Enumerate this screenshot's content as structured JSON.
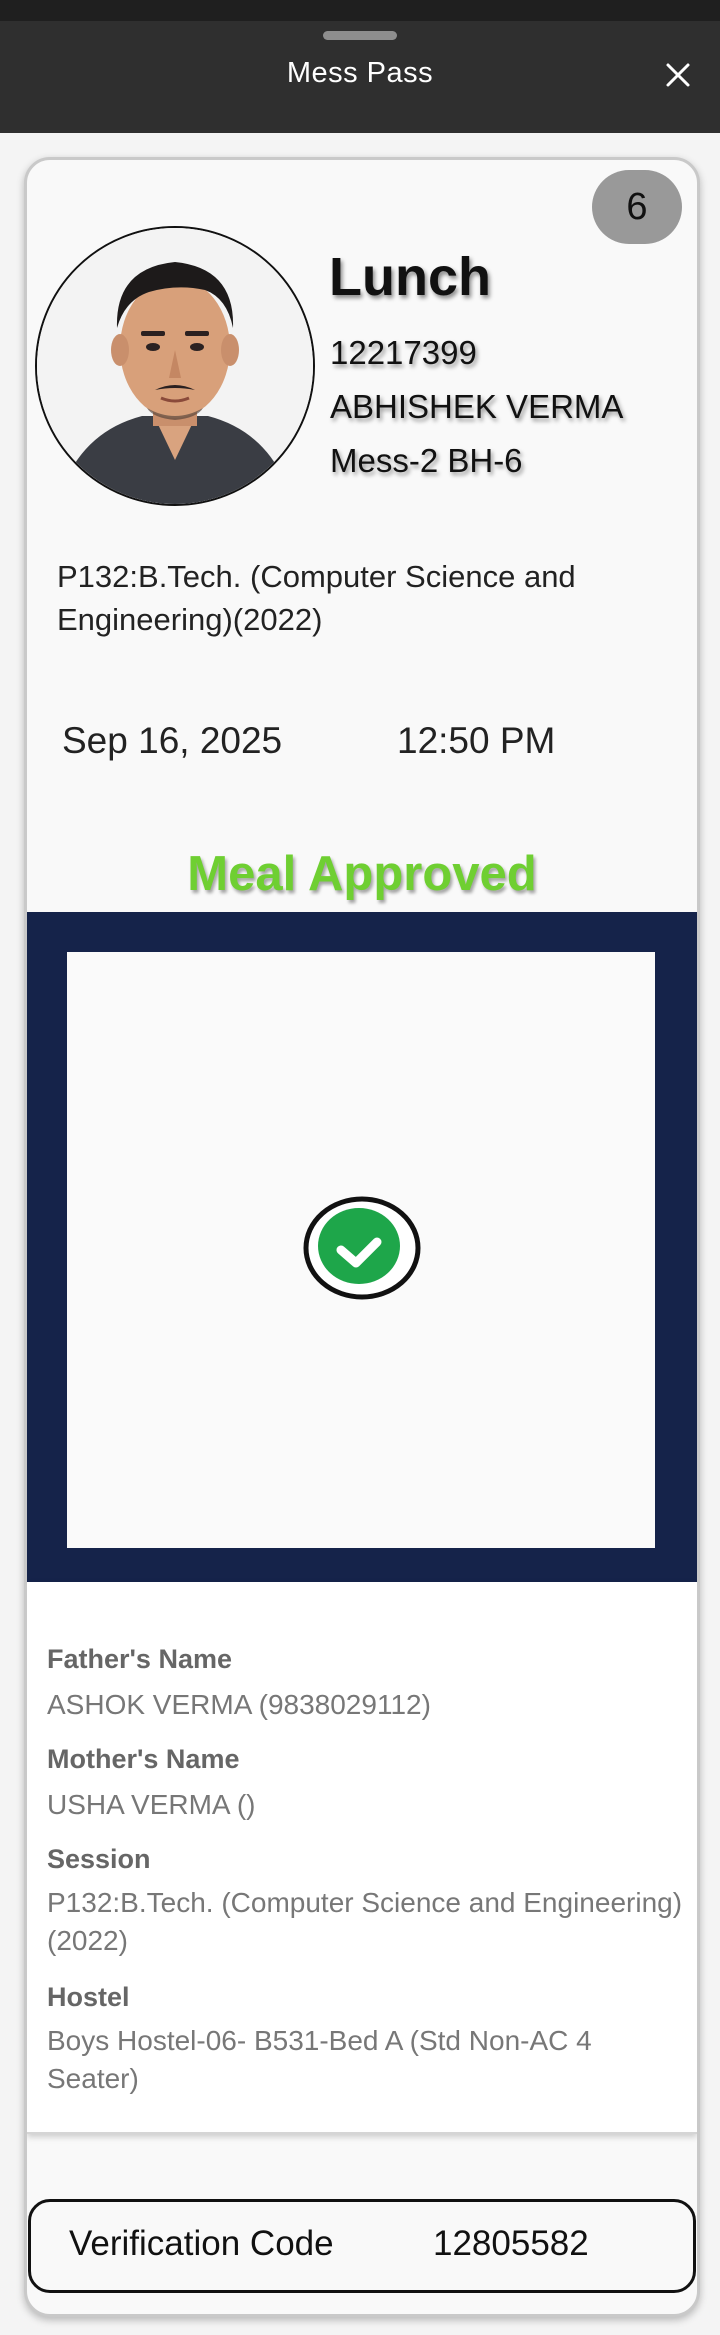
{
  "header": {
    "title": "Mess Pass",
    "close_icon": "close-icon"
  },
  "pass": {
    "count": "6",
    "meal_type": "Lunch",
    "roll_no": "12217399",
    "student_name": "ABHISHEK VERMA",
    "mess": "Mess-2 BH-6",
    "program": "P132:B.Tech. (Computer Science and Engineering)(2022)",
    "date": "Sep 16, 2025",
    "time": "12:50 PM",
    "status": "Meal Approved",
    "status_color": "#6fcf32",
    "status_icon": "check-circle-icon",
    "panel_color": "#15234a"
  },
  "details": {
    "father_label": "Father's Name",
    "father_value": "ASHOK VERMA (9838029112)",
    "mother_label": "Mother's Name",
    "mother_value": "USHA VERMA ()",
    "session_label": "Session",
    "session_value": "P132:B.Tech. (Computer Science and Engineering)(2022)",
    "hostel_label": "Hostel",
    "hostel_value": "Boys Hostel-06- B531-Bed A (Std Non-AC 4 Seater)"
  },
  "verification": {
    "label": "Verification Code",
    "code": "12805582"
  }
}
